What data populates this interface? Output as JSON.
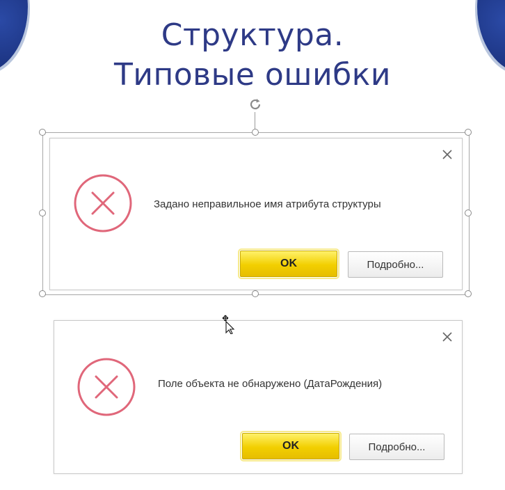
{
  "slide": {
    "title_line1": "Структура.",
    "title_line2": "Типовые ошибки"
  },
  "colors": {
    "title": "#2e3a86",
    "error_icon": "#e0677a",
    "ok_button": "#f2cf00"
  },
  "dialogs": [
    {
      "message": "Задано неправильное имя атрибута структуры",
      "ok_label": "OK",
      "details_label": "Подробно...",
      "icon": "error-circle-x-icon",
      "close_icon": "close-icon"
    },
    {
      "message": "Поле объекта не обнаружено (ДатаРождения)",
      "ok_label": "OK",
      "details_label": "Подробно...",
      "icon": "error-circle-x-icon",
      "close_icon": "close-icon"
    }
  ]
}
